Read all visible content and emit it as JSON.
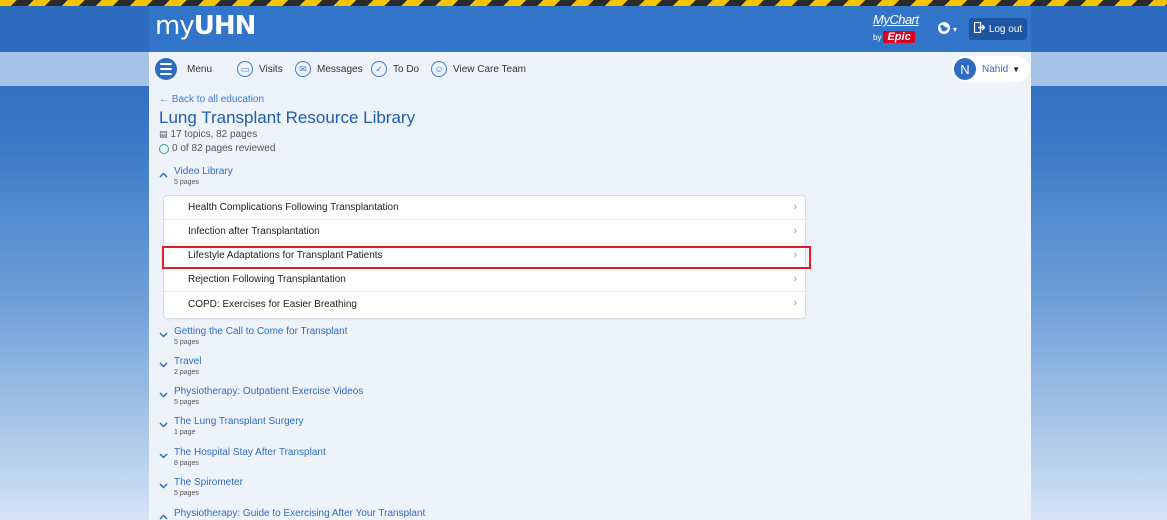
{
  "header": {
    "logo_prefix": "my",
    "logo_main": "UHN",
    "mychart_text": "MyChart",
    "mychart_by": "by",
    "mychart_epic": "Epic",
    "logout_label": "Log out"
  },
  "nav": {
    "menu": "Menu",
    "visits": "Visits",
    "messages": "Messages",
    "todo": "To Do",
    "care_team": "View Care Team",
    "user_initial": "N",
    "user_name": "Nahid"
  },
  "main": {
    "back_link": "← Back to all education",
    "title": "Lung Transplant Resource Library",
    "summary": "17 topics, 82 pages",
    "progress": "0 of 82 pages reviewed"
  },
  "expanded_topic": {
    "title": "Video Library",
    "count": "5 pages",
    "pages": [
      "Health Complications Following Transplantation",
      "Infection after Transplantation",
      "Lifestyle Adaptations for Transplant Patients",
      "Rejection Following Transplantation",
      "COPD: Exercises for Easier Breathing"
    ]
  },
  "collapsed_topics": [
    {
      "title": "Getting the Call to Come for Transplant",
      "count": "5 pages"
    },
    {
      "title": "Travel",
      "count": "2 pages"
    },
    {
      "title": "Physiotherapy: Outpatient Exercise Videos",
      "count": "5 pages"
    },
    {
      "title": "The Lung Transplant Surgery",
      "count": "1 page"
    },
    {
      "title": "The Hospital Stay After Transplant",
      "count": "8 pages"
    },
    {
      "title": "The Spirometer",
      "count": "5 pages"
    },
    {
      "title": "Physiotherapy: Guide to Exercising After Your Transplant",
      "count": ""
    }
  ],
  "colors": {
    "brand_blue": "#2f6cc0",
    "highlight_red": "#e31b23",
    "progress_green": "#2aa58a"
  }
}
